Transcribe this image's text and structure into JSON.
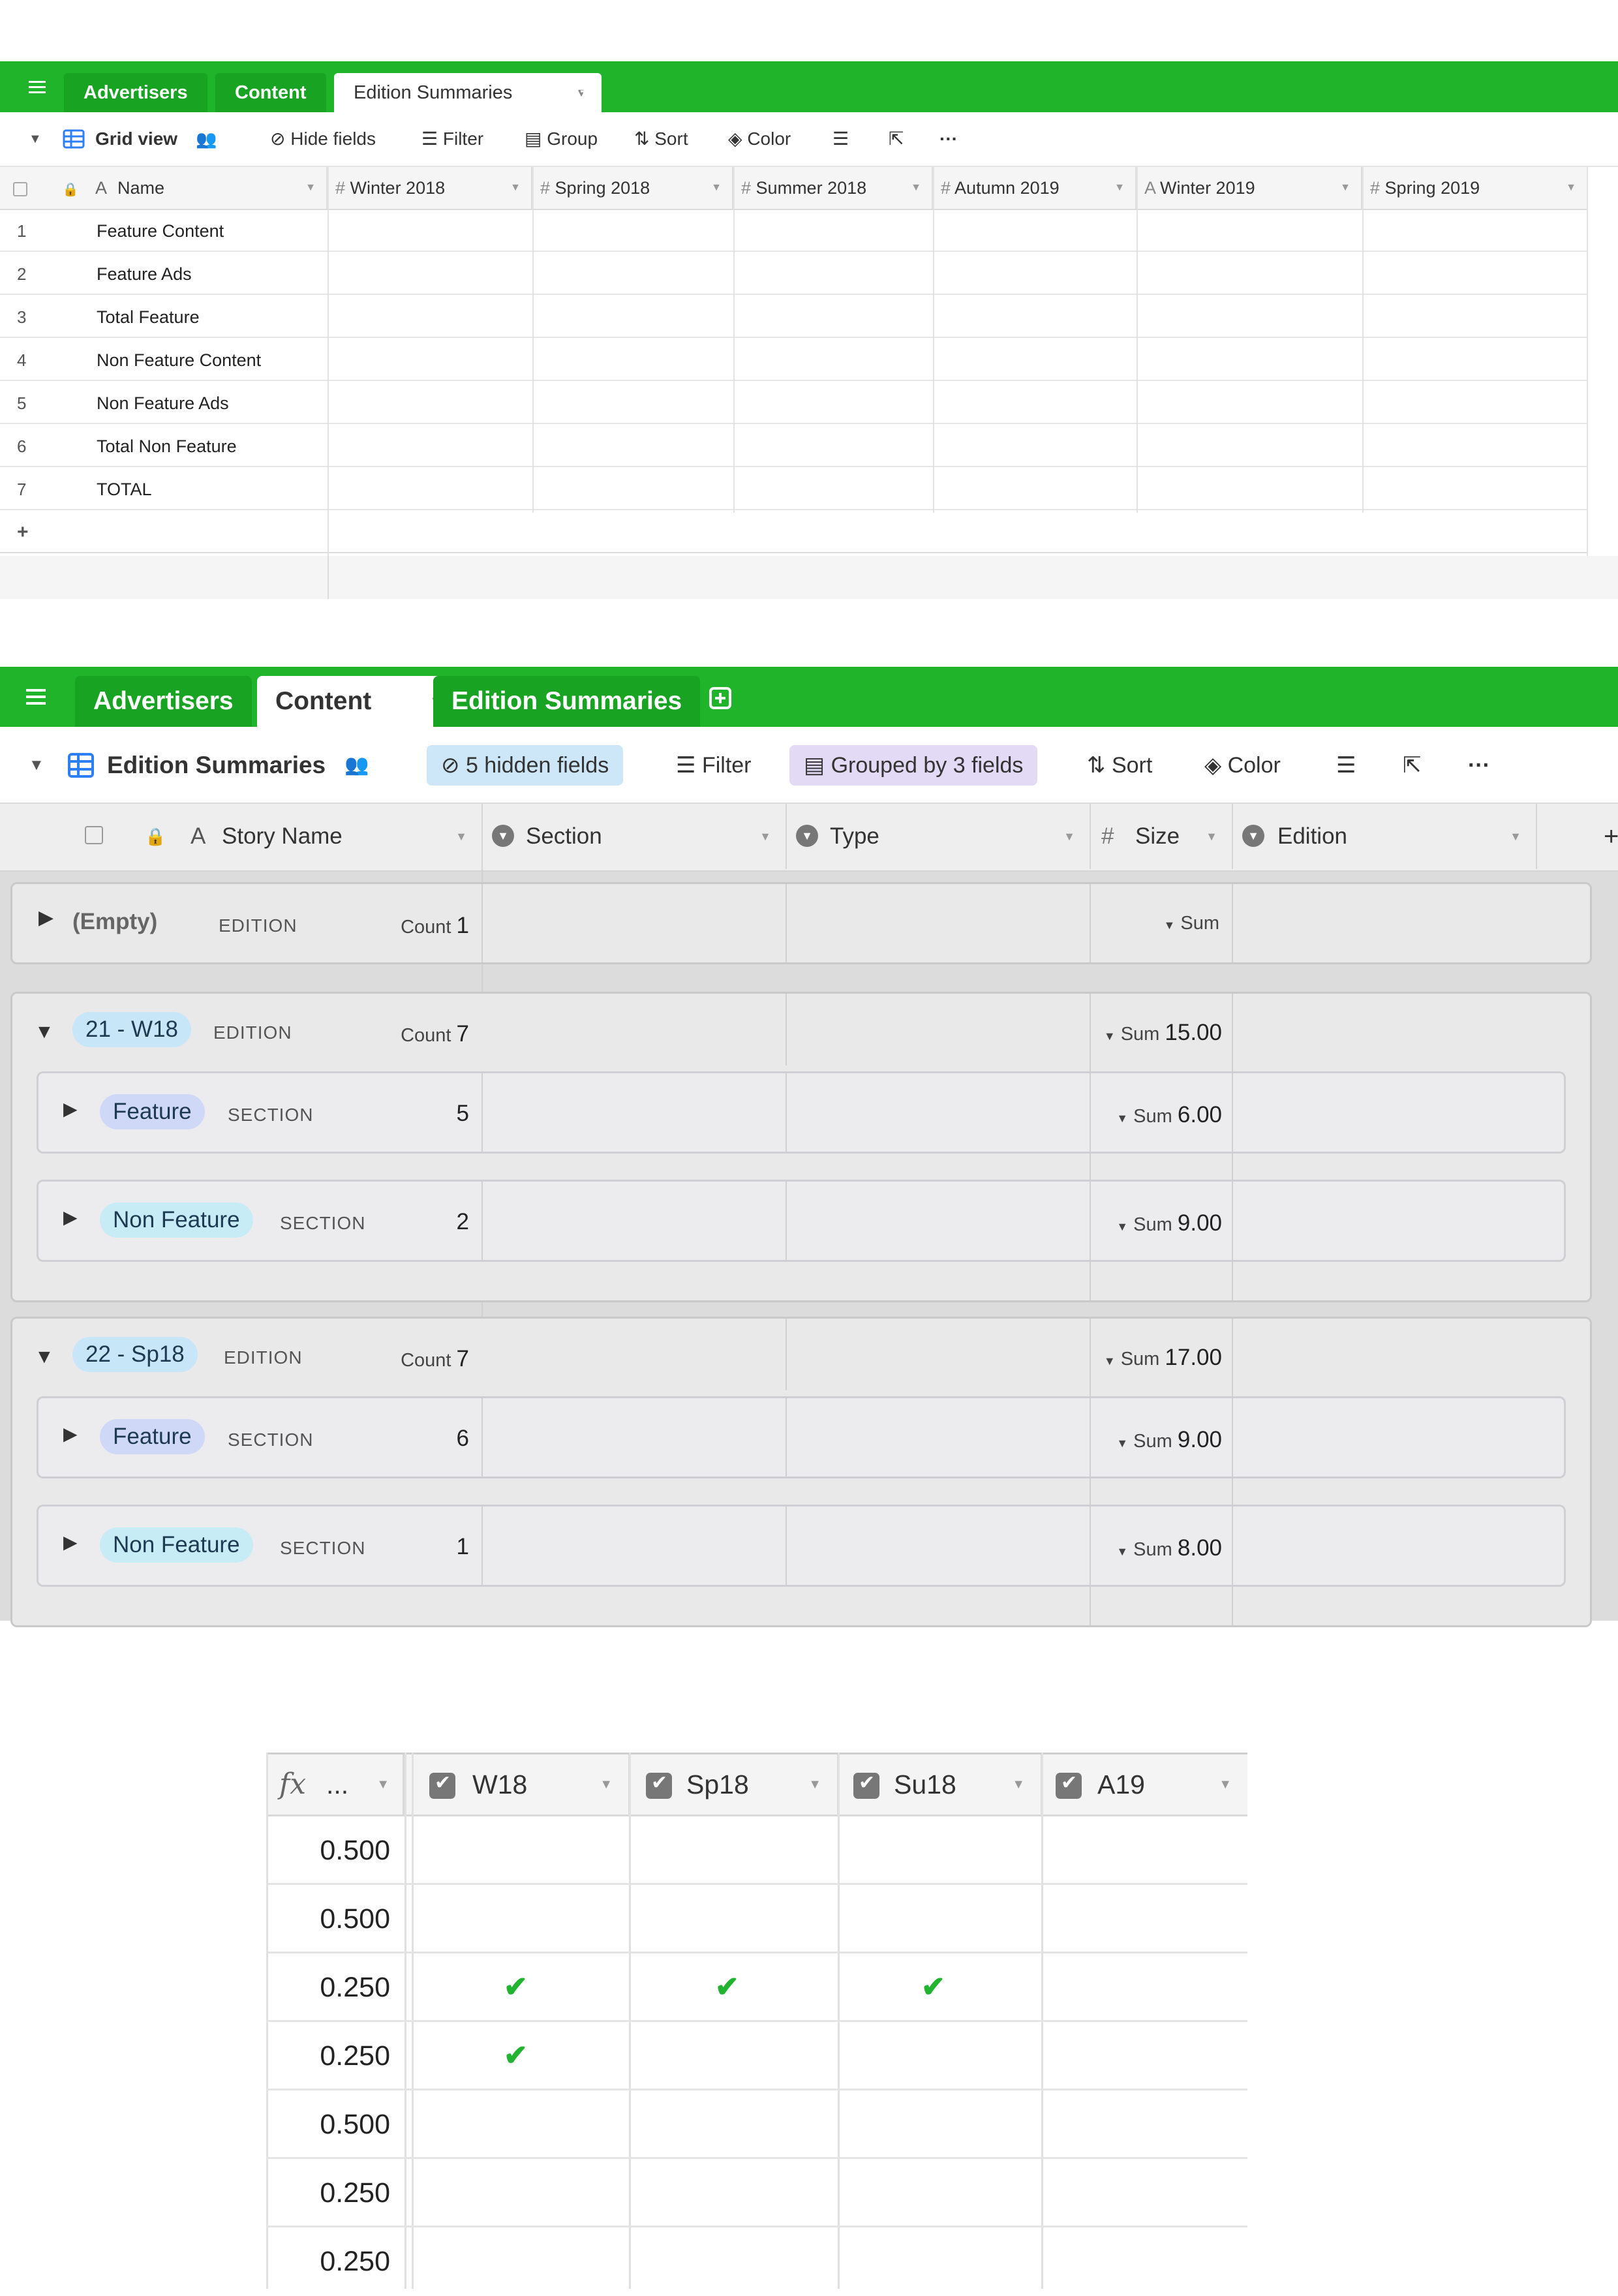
{
  "panel1": {
    "tabs": [
      "Advertisers",
      "Content",
      "Edition Summaries"
    ],
    "toolbar": {
      "view": "Grid view",
      "hide_fields": "Hide fields",
      "filter": "Filter",
      "group": "Group",
      "sort": "Sort",
      "color": "Color"
    },
    "columns": [
      "Name",
      "Winter 2018",
      "Spring 2018",
      "Summer 2018",
      "Autumn 2019",
      "Winter 2019",
      "Spring 2019"
    ],
    "rows": [
      {
        "num": "1",
        "name": "Feature Content"
      },
      {
        "num": "2",
        "name": "Feature Ads"
      },
      {
        "num": "3",
        "name": "Total Feature"
      },
      {
        "num": "4",
        "name": "Non Feature Content"
      },
      {
        "num": "5",
        "name": "Non Feature Ads"
      },
      {
        "num": "6",
        "name": "Total Non Feature"
      },
      {
        "num": "7",
        "name": "TOTAL"
      }
    ],
    "add_row": "+"
  },
  "panel2": {
    "tabs": [
      "Advertisers",
      "Content",
      "Edition Summaries"
    ],
    "toolbar": {
      "view": "Edition Summaries",
      "hidden": "5 hidden fields",
      "filter": "Filter",
      "grouped": "Grouped by 3 fields",
      "sort": "Sort",
      "color": "Color"
    },
    "columns": [
      "Story Name",
      "Section",
      "Type",
      "Size",
      "Edition"
    ],
    "labels": {
      "edition": "EDITION",
      "section": "SECTION",
      "count": "Count",
      "sum": "Sum"
    },
    "empty_group": {
      "name": "(Empty)",
      "count": "1"
    },
    "groups": [
      {
        "name": "21 - W18",
        "count": "7",
        "sum": "15.00",
        "subs": [
          {
            "name": "Feature",
            "count": "5",
            "sum": "6.00"
          },
          {
            "name": "Non Feature",
            "count": "2",
            "sum": "9.00"
          }
        ]
      },
      {
        "name": "22 - Sp18",
        "count": "7",
        "sum": "17.00",
        "subs": [
          {
            "name": "Feature",
            "count": "6",
            "sum": "9.00"
          },
          {
            "name": "Non Feature",
            "count": "1",
            "sum": "8.00"
          }
        ]
      }
    ]
  },
  "panel3": {
    "columns": [
      "...",
      "W18",
      "Sp18",
      "Su18",
      "A19"
    ],
    "formula_icon": "fx",
    "rows": [
      {
        "value": "0.500",
        "checks": [
          false,
          false,
          false,
          false
        ]
      },
      {
        "value": "0.500",
        "checks": [
          false,
          false,
          false,
          false
        ]
      },
      {
        "value": "0.250",
        "checks": [
          true,
          true,
          true,
          false
        ]
      },
      {
        "value": "0.250",
        "checks": [
          true,
          false,
          false,
          false
        ]
      },
      {
        "value": "0.500",
        "checks": [
          false,
          false,
          false,
          false
        ]
      },
      {
        "value": "0.250",
        "checks": [
          false,
          false,
          false,
          false
        ]
      },
      {
        "value": "0.250",
        "checks": [
          false,
          false,
          false,
          false
        ]
      }
    ],
    "check_glyph": "✔"
  },
  "colors": {
    "green": "#20b42b",
    "check": "#22b430"
  }
}
